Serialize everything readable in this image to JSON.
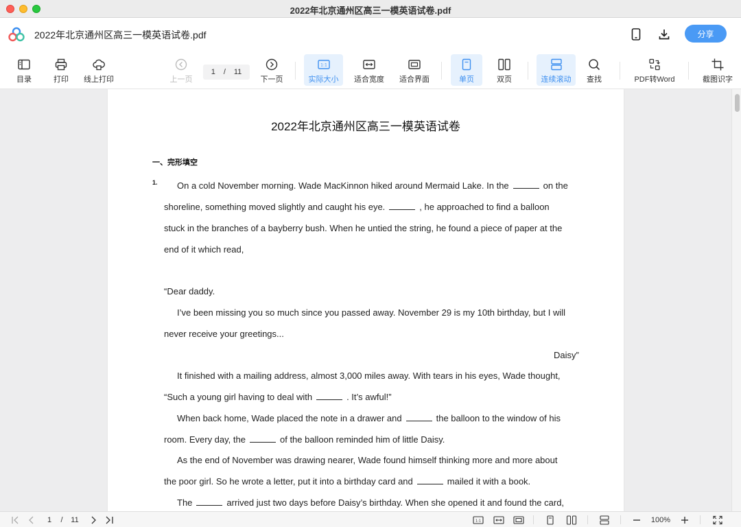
{
  "window": {
    "title": "2022年北京通州区高三一模英语试卷.pdf"
  },
  "appbar": {
    "doc_title": "2022年北京通州区高三一模英语试卷.pdf",
    "share_label": "分享"
  },
  "toolbar": {
    "toc": "目录",
    "print": "打印",
    "online_print": "线上打印",
    "prev_page": "上一页",
    "current_page": "1",
    "page_sep": "/",
    "total_pages": "11",
    "next_page": "下一页",
    "actual_size": "实际大小",
    "fit_width": "适合宽度",
    "fit_window": "适合界面",
    "single_page": "单页",
    "double_page": "双页",
    "continuous": "连续滚动",
    "search": "查找",
    "pdf_to_word": "PDF转Word",
    "ocr": "截图识字"
  },
  "document": {
    "title": "2022年北京通州区高三一模英语试卷",
    "section": "一、完形填空",
    "question_number": "1.",
    "lines": [
      {
        "id": "l1",
        "parts": [
          "On a cold November morning. Wade MacKinnon hiked around Mermaid Lake. In the",
          "on the"
        ]
      },
      {
        "id": "l2",
        "parts": [
          "shoreline, something moved slightly and caught his eye.",
          ", he approached to find a balloon"
        ]
      },
      {
        "id": "l3",
        "parts": [
          "stuck in the branches of a bayberry bush. When he untied the string, he found a piece of paper at the"
        ]
      },
      {
        "id": "l4",
        "parts": [
          "end of it which read,"
        ]
      },
      {
        "id": "l5",
        "parts": [
          "“Dear daddy."
        ]
      },
      {
        "id": "l6",
        "parts": [
          "I’ve been missing you so much since you passed away. November 29 is my 10th birthday, but I will"
        ]
      },
      {
        "id": "l7",
        "parts": [
          "never receive your greetings..."
        ]
      },
      {
        "id": "l8",
        "parts": [
          "Daisy”"
        ]
      },
      {
        "id": "l9",
        "parts": [
          "It finished with a mailing address, almost 3,000 miles away. With tears in his eyes, Wade thought,"
        ]
      },
      {
        "id": "l10",
        "parts": [
          "“Such a young girl having to deal with",
          ". It’s awful!”"
        ]
      },
      {
        "id": "l11",
        "parts": [
          "When back home, Wade placed the note in a drawer and",
          "the balloon to the window of his"
        ]
      },
      {
        "id": "l12",
        "parts": [
          "room. Every day, the",
          "of the balloon reminded him of little Daisy."
        ]
      },
      {
        "id": "l13",
        "parts": [
          "As the end of November was drawing nearer, Wade found himself thinking more and more about"
        ]
      },
      {
        "id": "l14",
        "parts": [
          "the poor girl. So he wrote a letter, put it into a birthday card and",
          "mailed it with a book."
        ]
      },
      {
        "id": "l15",
        "parts": [
          "The",
          "arrived just two days before Daisy’s birthday. When she opened it and found the card,"
        ]
      }
    ]
  },
  "statusbar": {
    "current_page": "1",
    "page_sep": "/",
    "total_pages": "11",
    "zoom": "100%"
  },
  "colors": {
    "accent": "#4a9af5",
    "active_bg": "#e6f1fd",
    "active_text": "#3d8ff0"
  }
}
